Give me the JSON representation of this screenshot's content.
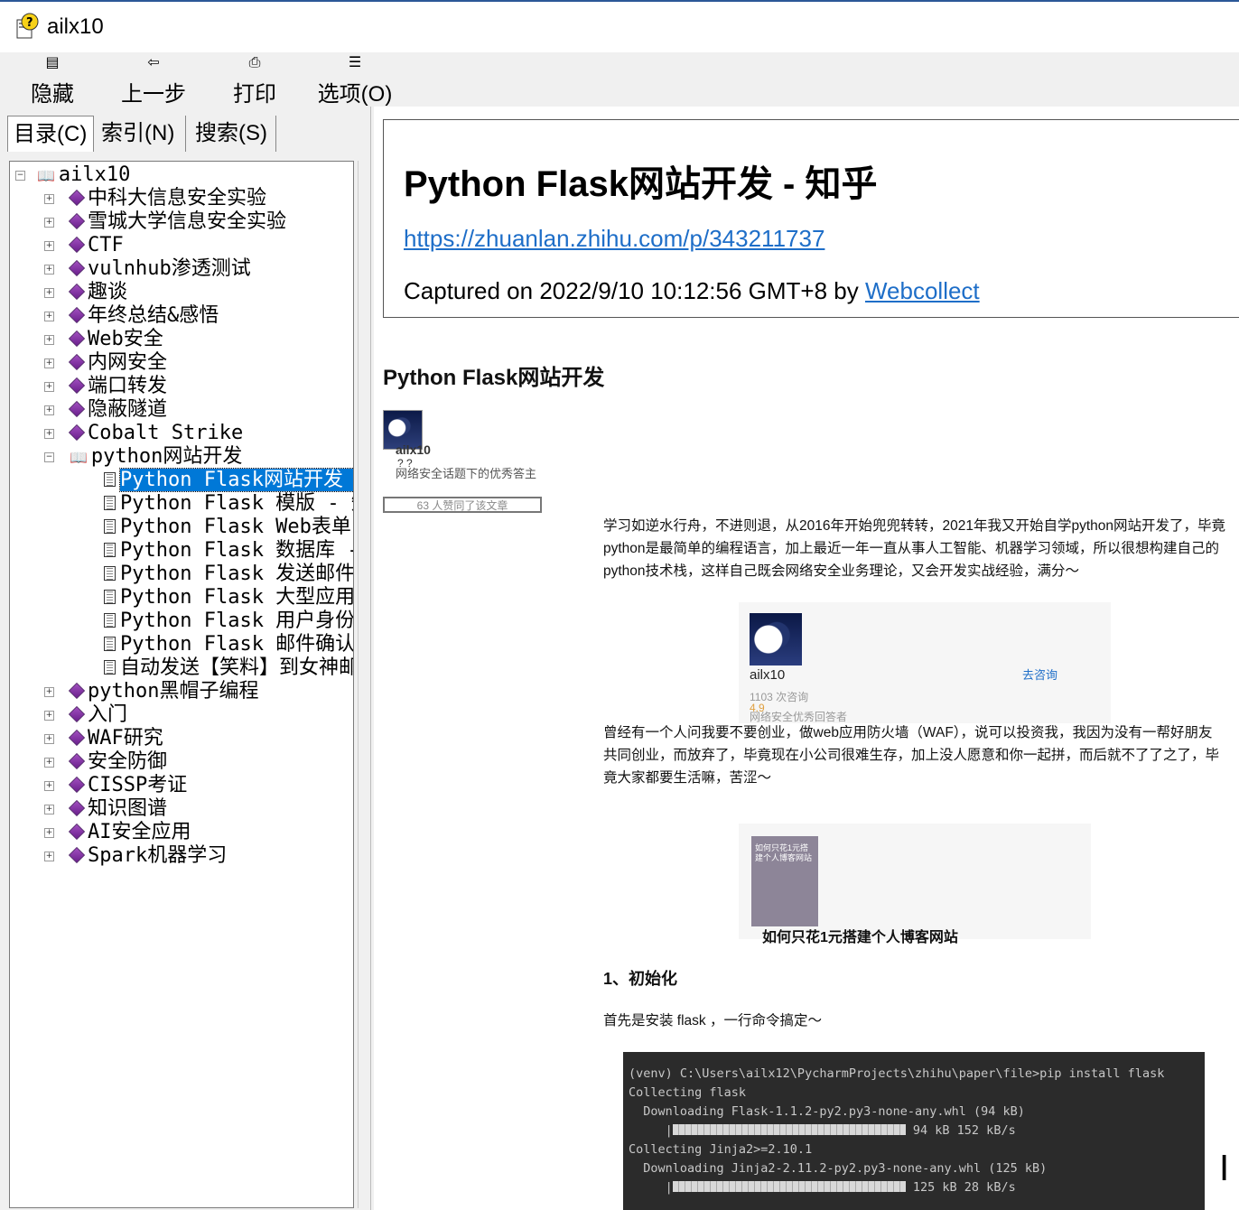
{
  "window": {
    "title": "ailx10"
  },
  "toolbar": {
    "hide_label": "隐藏",
    "back_label": "上一步",
    "print_label": "打印",
    "options_label": "选项(O)"
  },
  "tabs": {
    "contents": "目录(C)",
    "index": "索引(N)",
    "search": "搜索(S)"
  },
  "tree": {
    "root": "ailx10",
    "items": [
      "中科大信息安全实验",
      "雪城大学信息安全实验",
      "CTF",
      "vulnhub渗透测试",
      "趣谈",
      "年终总结&感悟",
      "Web安全",
      "内网安全",
      "端口转发",
      "隐蔽隧道",
      "Cobalt Strike"
    ],
    "open_folder": "python网站开发",
    "pages": [
      "Python Flask网站开发 - 知乎",
      "Python Flask 模版 - 知乎",
      "Python Flask Web表单 - 知乎",
      "Python Flask 数据库 - 知乎",
      "Python Flask 发送邮件",
      "Python Flask 大型应用的结构",
      "Python Flask 用户身份验证",
      "Python Flask 邮件确认用户",
      "自动发送【笑料】到女神邮箱"
    ],
    "items_after": [
      "python黑帽子编程",
      "入门",
      "WAF研究",
      "安全防御",
      "CISSP考证",
      "知识图谱",
      "AI安全应用",
      "Spark机器学习"
    ]
  },
  "capture": {
    "title": "Python Flask网站开发 - 知乎",
    "url": "https://zhuanlan.zhihu.com/p/343211737",
    "captured_prefix": "Captured on 2022/9/10 10:12:56 GMT+8 by ",
    "captured_by": "Webcollect"
  },
  "article": {
    "title": "Python Flask网站开发",
    "author": "ailx10",
    "author_q": "? ?",
    "author_desc": "网络安全话题下的优秀答主",
    "likes": "63 人赞同了该文章",
    "para1": "学习如逆水行舟，不进则退，从2016年开始兜兜转转，2021年我又开始自学python网站开发了，毕竟python是最简单的编程语言，加上最近一年一直从事人工智能、机器学习领域，所以很想构建自己的python技术栈，这样自己既会网络安全业务理论，又会开发实战经验，满分～",
    "card1": {
      "name": "ailx10",
      "count": "1103 次咨询",
      "rating": "4.9",
      "desc": "网络安全优秀回答者",
      "link": "去咨询"
    },
    "para2": "曾经有一个人问我要不要创业，做web应用防火墙（WAF），说可以投资我，我因为没有一帮好朋友共同创业，而放弃了，毕竟现在小公司很难生存，加上没人愿意和你一起拼，而后就不了了之了，毕竟大家都要生活嘛，苦涩～",
    "card2": {
      "cover_text": "如何只花1元搭建个人博客网站",
      "title": "如何只花1元搭建个人博客网站"
    },
    "section1": "1、初始化",
    "para3": "首先是安装 flask ，一行命令搞定～",
    "code": [
      "(venv) C:\\Users\\ailx12\\PycharmProjects\\zhihu\\paper\\file>pip install flask",
      "Collecting flask",
      "  Downloading Flask-1.1.2-py2.py3-none-any.whl (94 kB)",
      "     |",
      " 94 kB 152 kB/s",
      "Collecting Jinja2>=2.10.1",
      "  Downloading Jinja2-2.11.2-py2.py3-none-any.whl (125 kB)",
      "     |",
      " 125 kB 28 kB/s"
    ]
  }
}
